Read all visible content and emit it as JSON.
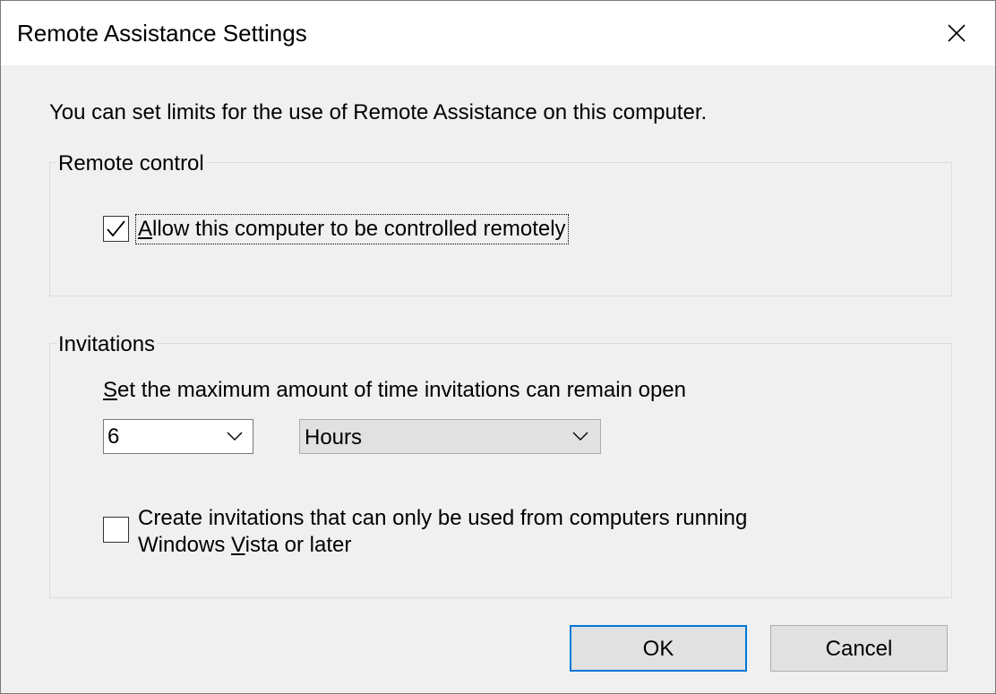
{
  "window": {
    "title": "Remote Assistance Settings",
    "close_icon": "close-icon"
  },
  "intro_text": "You can set limits for the use of Remote Assistance on this computer.",
  "remote_control": {
    "legend": "Remote control",
    "allow_checkbox": {
      "checked": true,
      "label_mnemonic": "A",
      "label_rest": "llow this computer to be controlled remotely"
    }
  },
  "invitations": {
    "legend": "Invitations",
    "time_label_mnemonic": "S",
    "time_label_rest": "et the maximum amount of time invitations can remain open",
    "duration_value": "6",
    "duration_unit": "Hours",
    "vista_checkbox": {
      "checked": false,
      "label_line1": "Create invitations that can only be used from computers running",
      "label_line2_prefix": "Windows ",
      "label_line2_mnemonic": "V",
      "label_line2_suffix": "ista or later"
    }
  },
  "buttons": {
    "ok_label": "OK",
    "cancel_label": "Cancel"
  },
  "colors": {
    "focus_border": "#0078d7",
    "dialog_bg": "#f0f0f0",
    "titlebar_bg": "#ffffff"
  }
}
